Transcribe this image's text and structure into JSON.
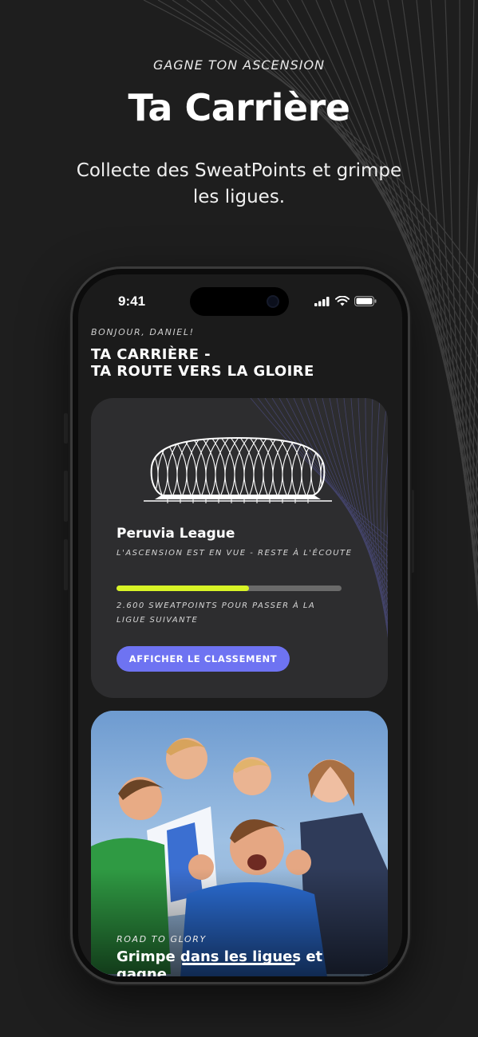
{
  "hero": {
    "kicker": "GAGNE TON ASCENSION",
    "title": "Ta Carrière",
    "subtitle": "Collecte des SweatPoints et grimpe les ligues."
  },
  "status_bar": {
    "time": "9:41",
    "icons": [
      "cellular-signal-icon",
      "wifi-icon",
      "battery-icon"
    ]
  },
  "screen": {
    "greeting": "BONJOUR, DANIEL!",
    "title_line1": "TA CARRIÈRE -",
    "title_line2": "TA ROUTE VERS LA GLOIRE"
  },
  "league_card": {
    "league_name": "Peruvia League",
    "tagline": "L'ASCENSION EST EN VUE - RESTE À L'ÉCOUTE",
    "progress_fraction": 0.59,
    "progress_text": "2.600 SWEATPOINTS POUR PASSER À LA LIGUE SUIVANTE",
    "button_label": "AFFICHER LE CLASSEMENT"
  },
  "photo_card": {
    "kicker": "ROAD TO GLORY",
    "title": "Grimpe dans les ligues et gagne"
  },
  "colors": {
    "background": "#1e1e1e",
    "card": "#2d2d2f",
    "progress_fill": "#d8f326",
    "progress_track": "#6a6a6a",
    "button": "#6e73f2"
  }
}
